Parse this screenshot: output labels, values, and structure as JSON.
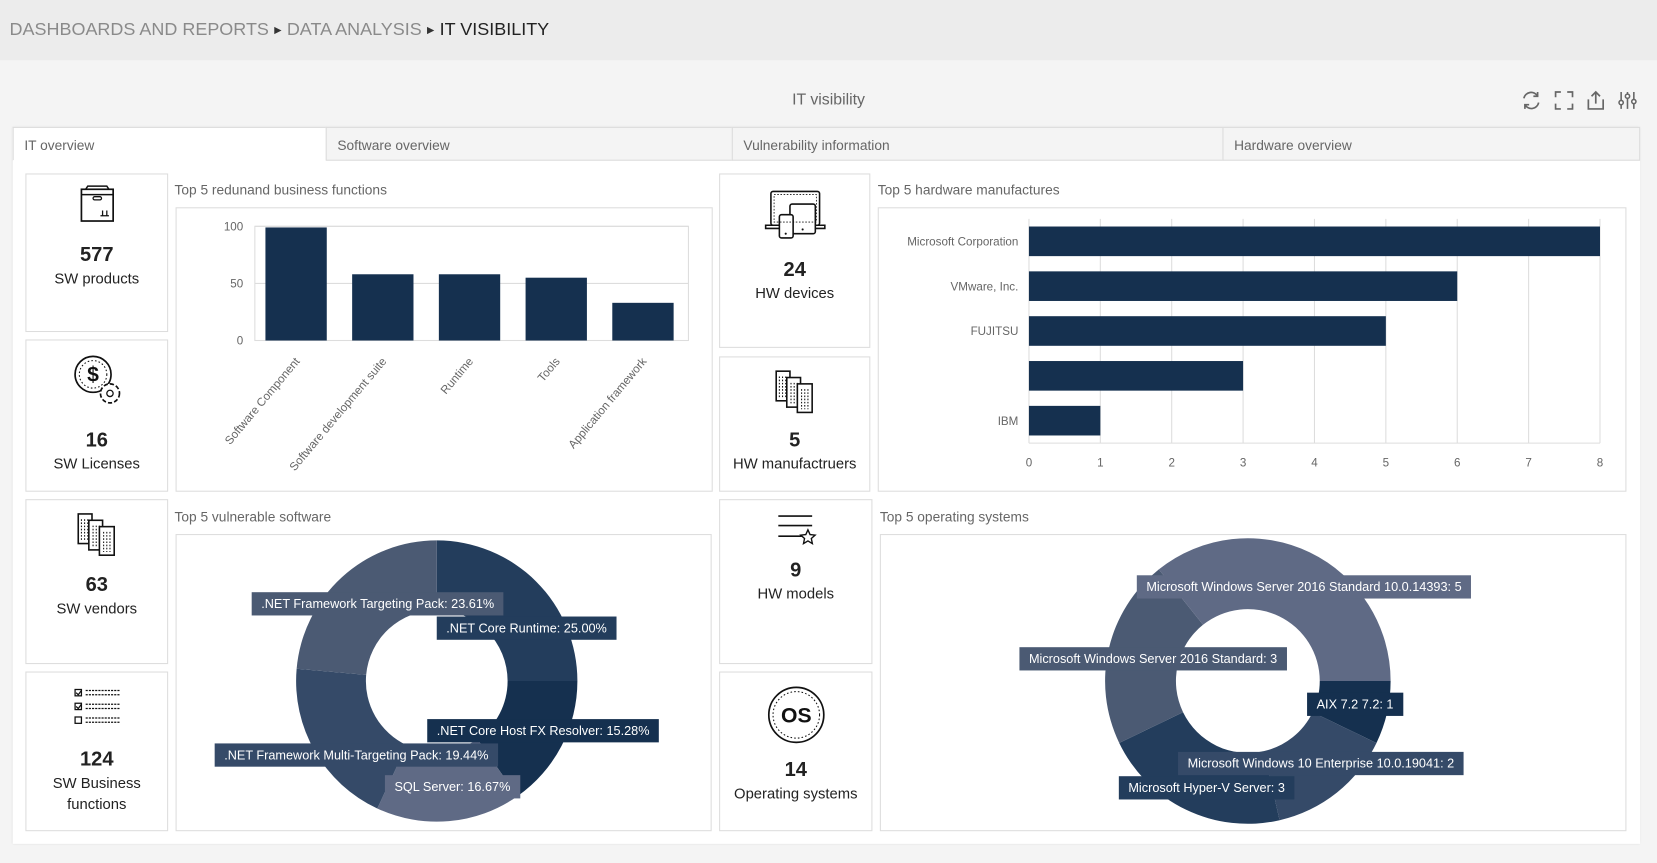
{
  "breadcrumb": [
    "DASHBOARDS AND REPORTS",
    "DATA ANALYSIS",
    "IT VISIBILITY"
  ],
  "page_title": "IT visibility",
  "toolbar_icons": [
    "refresh-icon",
    "fullscreen-icon",
    "export-icon",
    "settings-sliders-icon"
  ],
  "tabs": [
    {
      "label": "IT overview",
      "active": true
    },
    {
      "label": "Software overview"
    },
    {
      "label": "Vulnerability information"
    },
    {
      "label": "Hardware overview"
    }
  ],
  "kpis": [
    {
      "value": "577",
      "label": "SW products",
      "icon": "package-box-icon"
    },
    {
      "value": "16",
      "label": "SW Licenses",
      "icon": "dollar-gear-icon"
    },
    {
      "value": "63",
      "label": "SW vendors",
      "icon": "buildings-icon"
    },
    {
      "value": "124",
      "label": "SW Business functions",
      "icon": "checklist-icon"
    },
    {
      "value": "24",
      "label": "HW devices",
      "icon": "devices-icon"
    },
    {
      "value": "5",
      "label": "HW manufactruers",
      "icon": "buildings-icon"
    },
    {
      "value": "9",
      "label": "HW models",
      "icon": "list-star-icon"
    },
    {
      "value": "14",
      "label": "Operating systems",
      "icon": "os-badge-icon"
    }
  ],
  "colors": {
    "bar": "#15304f",
    "donut": [
      "#233d5c",
      "#15304f",
      "#5f6a85",
      "#354a68",
      "#4b5a73"
    ]
  },
  "chart_data": [
    {
      "type": "bar",
      "title": "Top 5 redunand business functions",
      "categories": [
        "Software Component",
        "Software development suite",
        "Runtime",
        "Tools",
        "Application framework"
      ],
      "values": [
        99,
        58,
        58,
        55,
        33
      ],
      "ylim": [
        0,
        100
      ],
      "yticks": [
        0,
        50,
        100
      ],
      "grid": true
    },
    {
      "type": "bar",
      "orientation": "horizontal",
      "title": "Top 5 hardware manufactures",
      "categories": [
        "Microsoft Corporation",
        "VMware, Inc.",
        "FUJITSU",
        "",
        "IBM"
      ],
      "values": [
        8,
        6,
        5,
        3,
        1
      ],
      "xlim": [
        0,
        8
      ],
      "xticks": [
        0,
        1,
        2,
        3,
        4,
        5,
        6,
        7,
        8
      ],
      "grid": true
    },
    {
      "type": "pie",
      "donut": true,
      "title": "Top 5 vulnerable software",
      "labels": [
        ".NET Core Runtime",
        ".NET Core Host FX Resolver",
        "SQL Server",
        ".NET Framework Multi-Targeting Pack",
        ".NET Framework Targeting Pack"
      ],
      "values": [
        25.0,
        15.28,
        16.67,
        19.44,
        23.61
      ],
      "data_labels": [
        ".NET Core Runtime: 25.00%",
        ".NET Core Host FX Resolver: 15.28%",
        "SQL Server: 16.67%",
        ".NET Framework Multi-Targeting Pack: 19.44%",
        ".NET Framework Targeting Pack: 23.61%"
      ]
    },
    {
      "type": "pie",
      "donut": true,
      "title": "Top 5 operating systems",
      "labels": [
        "AIX 7.2 7.2",
        "Microsoft Windows 10 Enterprise  10.0.19041",
        "Microsoft Hyper-V Server",
        "Microsoft Windows Server 2016 Standard",
        "Microsoft Windows Server 2016 Standard  10.0.14393"
      ],
      "values": [
        1,
        2,
        3,
        3,
        5
      ],
      "data_labels": [
        "AIX 7.2 7.2: 1",
        "Microsoft Windows 10 Enterprise  10.0.19041: 2",
        "Microsoft Hyper-V Server: 3",
        "Microsoft Windows Server 2016 Standard: 3",
        "Microsoft Windows Server 2016 Standard  10.0.14393: 5"
      ],
      "colors": [
        "#15304f",
        "#354a68",
        "#233d5c",
        "#4b5a73",
        "#5f6a85"
      ]
    }
  ]
}
